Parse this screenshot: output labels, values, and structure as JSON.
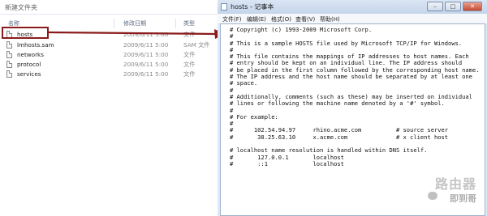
{
  "explorer": {
    "title": "新建文件夹",
    "columns": {
      "name": "名称",
      "date": "修改日期",
      "type": "类型"
    },
    "files": [
      {
        "name": "hosts",
        "date": "2009/6/11 5:00",
        "type": "文件"
      },
      {
        "name": "lmhosts.sam",
        "date": "2009/6/11 5:00",
        "type": "SAM 文件"
      },
      {
        "name": "networks",
        "date": "2009/6/11 5:00",
        "type": "文件"
      },
      {
        "name": "protocol",
        "date": "2009/6/11 5:00",
        "type": "文件"
      },
      {
        "name": "services",
        "date": "2009/6/11 5:00",
        "type": "文件"
      }
    ]
  },
  "notepad": {
    "title": "hosts - 记事本",
    "window_buttons": {
      "minimize": "–",
      "maximize": "□",
      "close": "✕"
    },
    "menu": [
      "文件(F)",
      "编辑(E)",
      "格式(O)",
      "查看(V)",
      "帮助(H)"
    ],
    "content": "# Copyright (c) 1993-2009 Microsoft Corp.\n#\n# This is a sample HOSTS file used by Microsoft TCP/IP for Windows.\n#\n# This file contains the mappings of IP addresses to host names. Each\n# entry should be kept on an individual line. The IP address should\n# be placed in the first column followed by the corresponding host name.\n# The IP address and the host name should be separated by at least one\n# space.\n#\n# Additionally, comments (such as these) may be inserted on individual\n# lines or following the machine name denoted by a '#' symbol.\n#\n# For example:\n#\n#      102.54.94.97     rhino.acme.com          # source server\n#       38.25.63.10     x.acme.com              # x client host\n\n# localhost name resolution is handled within DNS itself.\n#       127.0.0.1       localhost\n#       ::1             localhost"
  },
  "watermark": {
    "line1": "路由器",
    "line2": "即到哥"
  },
  "colors": {
    "highlight_border": "#8b1b1b",
    "arrow": "#8b1b1b",
    "window_frame": "#dfe9f5"
  }
}
